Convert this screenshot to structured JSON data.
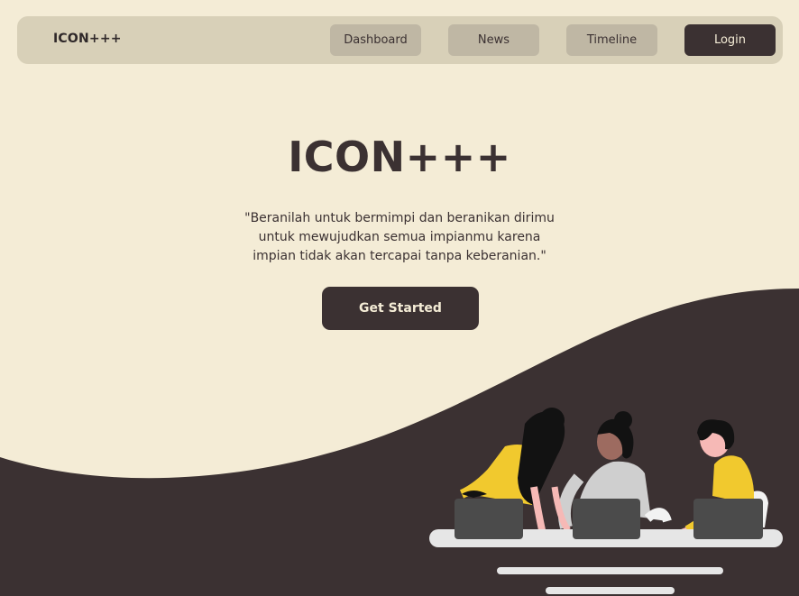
{
  "nav": {
    "brand": "ICON+++",
    "items": [
      {
        "label": "Dashboard"
      },
      {
        "label": "News"
      },
      {
        "label": "Timeline"
      }
    ],
    "login_label": "Login"
  },
  "hero": {
    "title": "ICON+++",
    "quote": "\"Beranilah untuk bermimpi dan beranikan dirimu untuk mewujudkan semua impianmu karena impian tidak akan tercapai tanpa keberanian.\"",
    "cta_label": "Get Started"
  },
  "colors": {
    "background": "#f4ecd6",
    "navbar": "#d8d0b8",
    "nav_button": "#bfb7a4",
    "dark": "#3b3132",
    "accent_yellow": "#f1c92e"
  }
}
